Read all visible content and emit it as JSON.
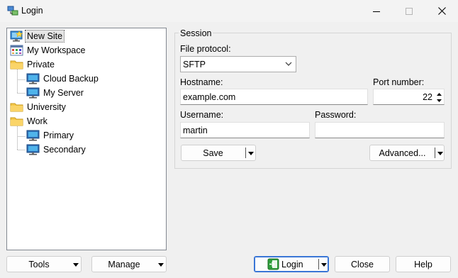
{
  "window": {
    "title": "Login"
  },
  "tree": {
    "items": [
      {
        "label": "New Site",
        "icon": "new-site-icon"
      },
      {
        "label": "My Workspace",
        "icon": "workspace-icon"
      },
      {
        "label": "Private",
        "icon": "folder-icon"
      },
      {
        "label": "Cloud Backup",
        "icon": "computer-icon"
      },
      {
        "label": "My Server",
        "icon": "computer-icon"
      },
      {
        "label": "University",
        "icon": "folder-icon"
      },
      {
        "label": "Work",
        "icon": "folder-icon"
      },
      {
        "label": "Primary",
        "icon": "computer-icon"
      },
      {
        "label": "Secondary",
        "icon": "computer-icon"
      }
    ]
  },
  "session": {
    "title": "Session",
    "file_protocol_label": "File protocol:",
    "file_protocol_value": "SFTP",
    "hostname_label": "Hostname:",
    "hostname_value": "example.com",
    "port_label": "Port number:",
    "port_value": "22",
    "username_label": "Username:",
    "username_value": "martin",
    "password_label": "Password:",
    "password_value": "",
    "save_label": "Save",
    "advanced_label": "Advanced..."
  },
  "footer": {
    "tools_label": "Tools",
    "manage_label": "Manage",
    "login_label": "Login",
    "close_label": "Close",
    "help_label": "Help"
  },
  "colors": {
    "accent": "#3a76d6",
    "folder": "#f5c84a",
    "login_icon": "#2e9e3a"
  }
}
